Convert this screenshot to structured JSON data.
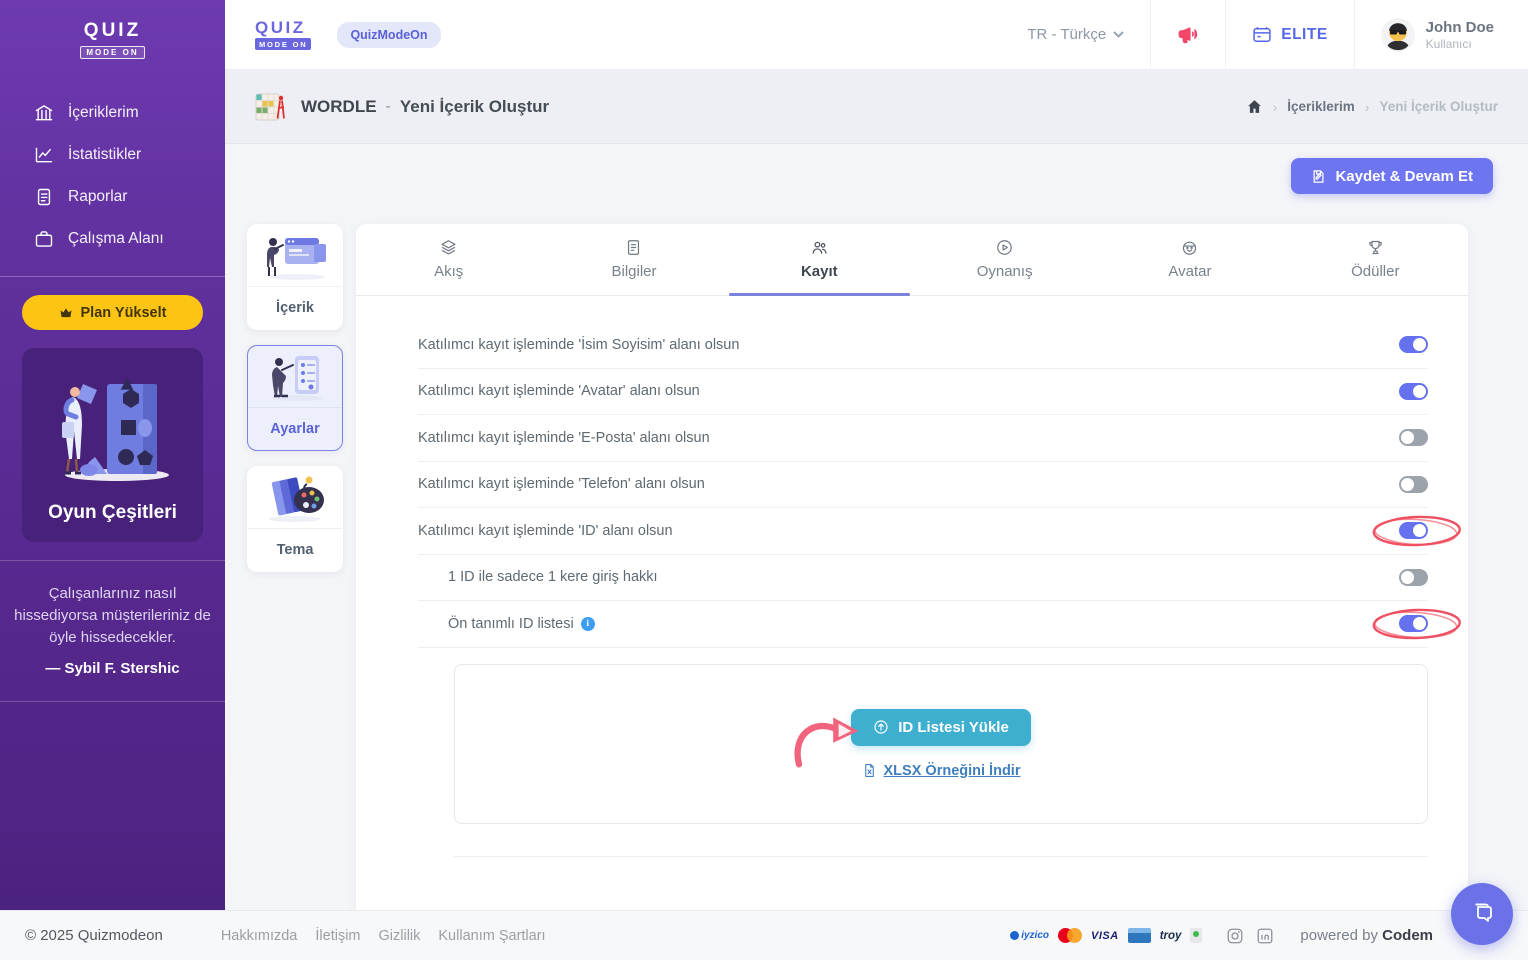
{
  "colors": {
    "sidebar_purple_top": "#6d3ab0",
    "sidebar_purple_bottom": "#4c2280",
    "accent_indigo": "#6d76f0",
    "toggle_on": "#6571ee",
    "toggle_off": "#9da3ab",
    "upgrade_yellow": "#fdc513",
    "upload_teal": "#3fafd0",
    "link_blue": "#3f7fc0",
    "annotation_red": "#ee5162",
    "elite_blue": "#5767ea",
    "megaphone_red": "#f2476b"
  },
  "icons": {
    "library-icon": "bank columns",
    "stats-icon": "line chart",
    "reports-icon": "document",
    "workspace-icon": "briefcase",
    "crown-icon": "crown",
    "home-icon": "house",
    "megaphone-icon": "megaphone",
    "elite-badge-icon": "id card",
    "chevron-down-icon": "caret",
    "save-icon": "page+pencil",
    "upload-icon": "circle up-arrow",
    "file-icon": "spreadsheet page",
    "info-icon": "i in circle",
    "chat-icon": "double speech bubbles",
    "instagram-icon": "camera square",
    "linkedin-icon": "in square",
    "tab-flow-icon": "layers",
    "tab-info-icon": "file lines",
    "tab-register-icon": "two users",
    "tab-gameplay-icon": "play circle",
    "tab-avatar-icon": "smiley face",
    "tab-rewards-icon": "trophy"
  },
  "sidebar": {
    "logo_line1": "QUIZ",
    "logo_line2": "MODE ON",
    "nav": [
      {
        "label": "İçeriklerim"
      },
      {
        "label": "İstatistikler"
      },
      {
        "label": "Raporlar"
      },
      {
        "label": "Çalışma Alanı"
      }
    ],
    "upgrade_label": "Plan Yükselt",
    "game_types_label": "Oyun Çeşitleri",
    "quote": "Çalışanlarınız nasıl hissediyorsa müşterileriniz de öyle hissedecekler.",
    "quote_author": "— Sybil F. Stershic"
  },
  "header": {
    "logo_line1": "QUIZ",
    "logo_line2": "MODE ON",
    "workspace_badge": "QuizModeOn",
    "language": "TR - Türkçe",
    "plan_badge": "ELITE",
    "user_name": "John Doe",
    "user_role": "Kullanıcı"
  },
  "title_bar": {
    "game": "WORDLE",
    "separator": "-",
    "subtitle": "Yeni İçerik Oluştur",
    "breadcrumb_1": "İçeriklerim",
    "breadcrumb_2": "Yeni İçerik Oluştur"
  },
  "actions": {
    "save_label": "Kaydet & Devam Et"
  },
  "settings_nav": [
    {
      "label": "İçerik",
      "active": false
    },
    {
      "label": "Ayarlar",
      "active": true
    },
    {
      "label": "Tema",
      "active": false
    }
  ],
  "tabs": [
    {
      "label": "Akış",
      "active": false
    },
    {
      "label": "Bilgiler",
      "active": false
    },
    {
      "label": "Kayıt",
      "active": true
    },
    {
      "label": "Oynanış",
      "active": false
    },
    {
      "label": "Avatar",
      "active": false
    },
    {
      "label": "Ödüller",
      "active": false
    }
  ],
  "settings": {
    "rows": [
      {
        "label": "Katılımcı kayıt işleminde 'İsim Soyisim' alanı olsun",
        "enabled": true,
        "indented": false,
        "highlighted": false,
        "info": false
      },
      {
        "label": "Katılımcı kayıt işleminde 'Avatar' alanı olsun",
        "enabled": true,
        "indented": false,
        "highlighted": false,
        "info": false
      },
      {
        "label": "Katılımcı kayıt işleminde 'E-Posta' alanı olsun",
        "enabled": false,
        "indented": false,
        "highlighted": false,
        "info": false
      },
      {
        "label": "Katılımcı kayıt işleminde 'Telefon' alanı olsun",
        "enabled": false,
        "indented": false,
        "highlighted": false,
        "info": false
      },
      {
        "label": "Katılımcı kayıt işleminde 'ID' alanı olsun",
        "enabled": true,
        "indented": false,
        "highlighted": true,
        "info": false
      },
      {
        "label": "1 ID ile sadece 1 kere giriş hakkı",
        "enabled": false,
        "indented": true,
        "highlighted": false,
        "info": false
      },
      {
        "label": "Ön tanımlı ID listesi",
        "enabled": true,
        "indented": true,
        "highlighted": true,
        "info": true
      }
    ],
    "upload_button": "ID Listesi Yükle",
    "download_link": "XLSX Örneğini İndir"
  },
  "footer": {
    "copyright": "© 2025 Quizmodeon",
    "links": [
      {
        "label": "Hakkımızda"
      },
      {
        "label": "İletişim"
      },
      {
        "label": "Gizlilik"
      },
      {
        "label": "Kullanım Şartları"
      }
    ],
    "payments": {
      "iyzico": "iyzico",
      "visa": "VISA",
      "troy": "troy"
    },
    "powered_by": "powered by",
    "powered_brand": "Codem"
  }
}
